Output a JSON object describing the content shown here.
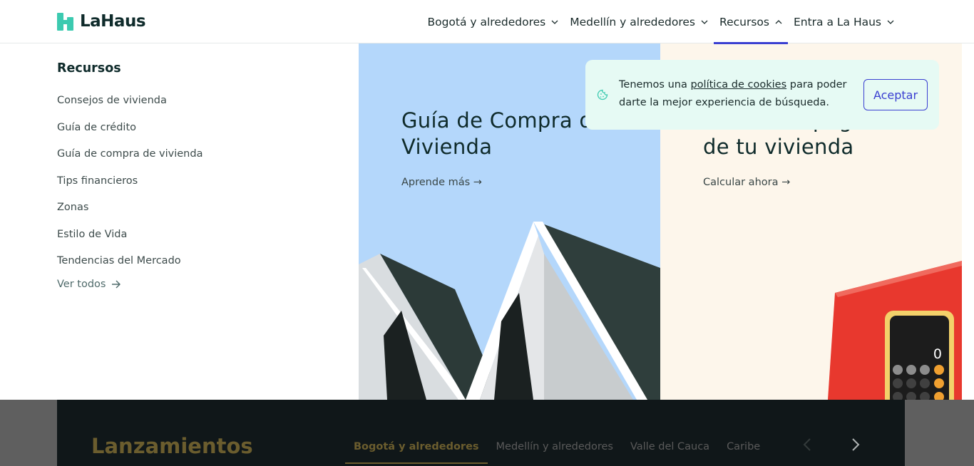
{
  "header": {
    "logo_text": "LaHaus",
    "nav": [
      {
        "label": "Bogotá y alrededores",
        "state": "down"
      },
      {
        "label": "Medellín y alrededores",
        "state": "down"
      },
      {
        "label": "Recursos",
        "state": "up"
      },
      {
        "label": "Entra a La Haus",
        "state": "down"
      }
    ],
    "accent": "#3a3fd1"
  },
  "menu": {
    "title": "Recursos",
    "items": [
      "Consejos de vivienda",
      "Guía de crédito",
      "Guía de compra de vivienda",
      "Tips financieros",
      "Zonas",
      "Estilo de Vida",
      "Tendencias del Mercado"
    ],
    "see_all": "Ver todos"
  },
  "cards": [
    {
      "title": "Guía de Compra de Vivienda",
      "link": "Aprende más →"
    },
    {
      "title_line1": "Calcula el pago",
      "title_line2": "de tu vivienda",
      "link": "Calcular ahora →"
    }
  ],
  "cookie": {
    "text_before": "Tenemos una ",
    "link": "política de cookies",
    "text_after": " para poder darte la mejor experiencia de búsqueda.",
    "button": "Aceptar"
  },
  "bottom": {
    "title": "Lanzamientos",
    "tabs": [
      "Bogotá y alrededores",
      "Medellín y alrededores",
      "Valle del Cauca",
      "Caribe"
    ]
  },
  "calculator_display": "0"
}
